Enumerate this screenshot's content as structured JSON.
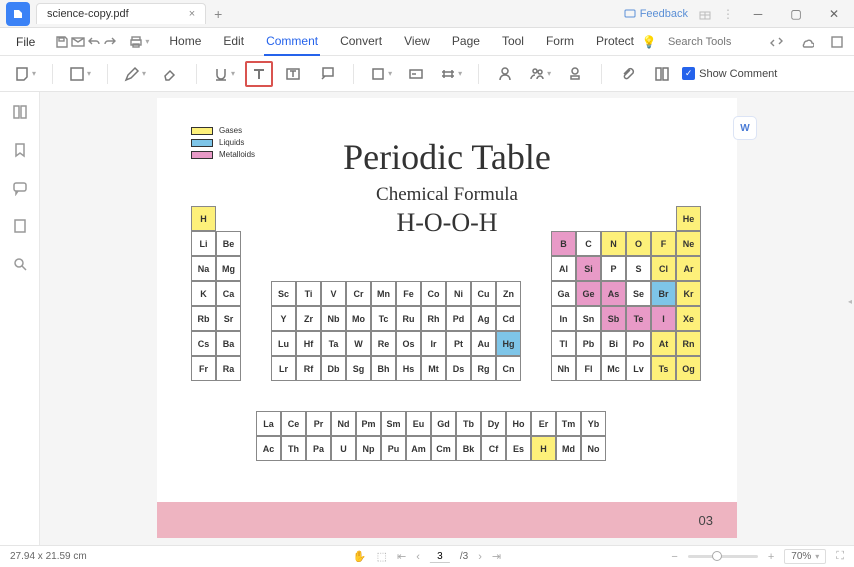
{
  "titlebar": {
    "filename": "science-copy.pdf",
    "feedback": "Feedback"
  },
  "menu": {
    "file": "File",
    "tabs": [
      "Home",
      "Edit",
      "Comment",
      "Convert",
      "View",
      "Page",
      "Tool",
      "Form",
      "Protect"
    ],
    "active_index": 2,
    "search_placeholder": "Search Tools"
  },
  "toolbar": {
    "show_comment": "Show Comment"
  },
  "page": {
    "title": "Periodic Table",
    "subtitle": "Chemical Formula",
    "formula": "H-O-O-H",
    "footer_num": "03",
    "legend": [
      {
        "label": "Gases",
        "color": "#fdf07a"
      },
      {
        "label": "Liquids",
        "color": "#7ec5e8"
      },
      {
        "label": "Metalloids",
        "color": "#e89ac7"
      }
    ],
    "elements": {
      "col1": [
        "H",
        "Li",
        "Na",
        "K",
        "Rb",
        "Cs",
        "Fr"
      ],
      "col2": [
        "Be",
        "Mg",
        "Ca",
        "Sr",
        "Ba",
        "Ra"
      ],
      "block_d": [
        [
          "Sc",
          "Ti",
          "V",
          "Cr",
          "Mn",
          "Fe",
          "Co",
          "Ni",
          "Cu",
          "Zn"
        ],
        [
          "Y",
          "Zr",
          "Nb",
          "Mo",
          "Tc",
          "Ru",
          "Rh",
          "Pd",
          "Ag",
          "Cd"
        ],
        [
          "Lu",
          "Hf",
          "Ta",
          "W",
          "Re",
          "Os",
          "Ir",
          "Pt",
          "Au",
          "Hg"
        ],
        [
          "Lr",
          "Rf",
          "Db",
          "Sg",
          "Bh",
          "Hs",
          "Mt",
          "Ds",
          "Rg",
          "Cn"
        ]
      ],
      "block_p_top": [
        "He"
      ],
      "block_p": [
        [
          "B",
          "C",
          "N",
          "O",
          "F",
          "Ne"
        ],
        [
          "Al",
          "Si",
          "P",
          "S",
          "Cl",
          "Ar"
        ],
        [
          "Ga",
          "Ge",
          "As",
          "Se",
          "Br",
          "Kr"
        ],
        [
          "In",
          "Sn",
          "Sb",
          "Te",
          "I",
          "Xe"
        ],
        [
          "Tl",
          "Pb",
          "Bi",
          "Po",
          "At",
          "Rn"
        ],
        [
          "Nh",
          "Fl",
          "Mc",
          "Lv",
          "Ts",
          "Og"
        ]
      ],
      "lanth": [
        [
          "La",
          "Ce",
          "Pr",
          "Nd",
          "Pm",
          "Sm",
          "Eu",
          "Gd",
          "Tb",
          "Dy",
          "Ho",
          "Er",
          "Tm",
          "Yb"
        ],
        [
          "Ac",
          "Th",
          "Pa",
          "U",
          "Np",
          "Pu",
          "Am",
          "Cm",
          "Bk",
          "Cf",
          "Es",
          "H",
          "Md",
          "No"
        ]
      ]
    },
    "special": {
      "yellow": [
        "H",
        "He",
        "N",
        "O",
        "F",
        "Ne",
        "Cl",
        "Ar",
        "Kr",
        "Xe",
        "Rn",
        "Og",
        "At",
        "Ts"
      ],
      "pink": [
        "B",
        "Si",
        "Ge",
        "As",
        "Sb",
        "Te",
        "I"
      ],
      "blue": [
        "Br",
        "Hg"
      ]
    }
  },
  "status": {
    "dims": "27.94 x 21.59 cm",
    "page_current": "3",
    "page_total": "/3",
    "zoom": "70%"
  }
}
